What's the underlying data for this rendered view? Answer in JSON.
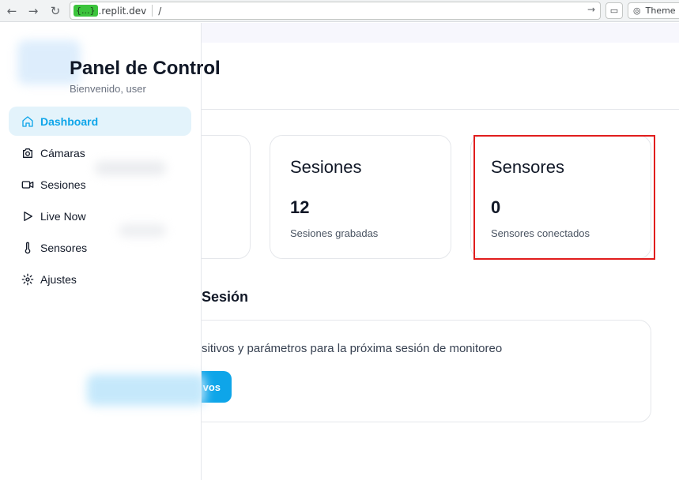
{
  "browser": {
    "url_highlight": "{...}",
    "url_domain": ".replit.dev",
    "url_path": "/",
    "theme_label": "Theme"
  },
  "header": {
    "title": "Panel de Control",
    "subtitle": "Bienvenido, user"
  },
  "sidebar": {
    "items": [
      {
        "label": "Dashboard",
        "icon": "home-icon",
        "active": true
      },
      {
        "label": "Cámaras",
        "icon": "camera-icon"
      },
      {
        "label": "Sesiones",
        "icon": "video-icon"
      },
      {
        "label": "Live Now",
        "icon": "play-icon"
      },
      {
        "label": "Sensores",
        "icon": "thermometer-icon"
      },
      {
        "label": "Ajustes",
        "icon": "gear-icon"
      }
    ]
  },
  "stats": {
    "sesiones": {
      "title": "Sesiones",
      "value": "12",
      "caption": "Sesiones grabadas"
    },
    "sensores": {
      "title": "Sensores",
      "value": "0",
      "caption": "Sensores conectados"
    }
  },
  "session_section": {
    "title": "Sesión",
    "text": "sitivos y parámetros para la próxima sesión de monitoreo",
    "button_label": "vos"
  },
  "colors": {
    "accent": "#0ea5e9",
    "active_bg": "#e3f3fb",
    "highlight_border": "#e11d1d"
  }
}
